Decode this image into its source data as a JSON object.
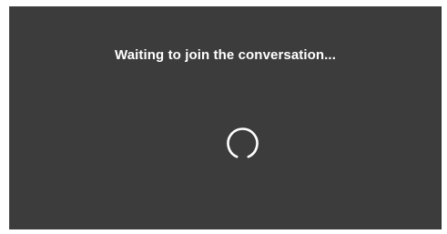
{
  "window": {
    "status_message": "Waiting to join the conversation...",
    "spinner_icon": "loading-spinner-icon"
  },
  "colors": {
    "background": "#3c3c3c",
    "text": "#ffffff",
    "spinner": "#ffffff"
  }
}
